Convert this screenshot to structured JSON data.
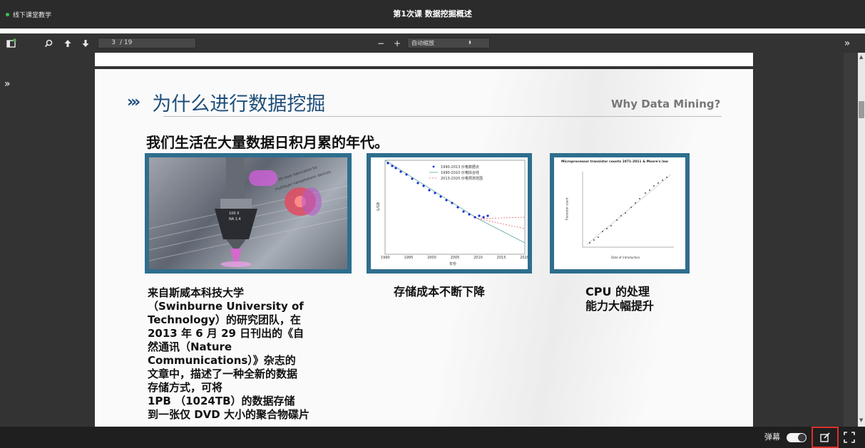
{
  "header": {
    "live_label": "线下课堂教学",
    "course_title": "第1次课 数据挖掘概述",
    "live_color": "#37c24a"
  },
  "toolbar": {
    "page_current": "3",
    "page_total": "/ 19",
    "zoom_minus": "−",
    "zoom_plus": "+",
    "zoom_value": "自动缩放",
    "sidebar_icon": "sidebar-toggle-icon",
    "find_icon": "search-icon",
    "prev_icon": "arrow-up-icon",
    "next_icon": "arrow-down-icon",
    "tools_label": "»"
  },
  "viewer": {
    "sidebar_expand": "»"
  },
  "slide": {
    "title_chevrons": "›››",
    "title": "为什么进行数据挖掘",
    "title_en": "Why Data Mining?",
    "subtitle": "我们生活在大量数据日积月累的年代。",
    "accent_color": "#1f4e79",
    "frame_color": "#2e6e8e",
    "cards": [
      {
        "lines": [
          "来自斯威本科技大学",
          "（Swinburne University of",
          "Technology）的研究团队，在",
          "2013 年 6 月 29 日刊出的《自",
          "然通讯（Nature",
          "Communications）》杂志的",
          "文章中，描述了一种全新的数据",
          "存储方式，可将",
          "1PB （1024TB）的数据存储",
          "到一张仅 DVD 大小的聚合物碟片"
        ]
      },
      {
        "lines": [
          "存储成本不断下降"
        ]
      },
      {
        "lines": [
          "CPU 的处理",
          "能力大幅提升"
        ]
      }
    ],
    "photo_labels": [
      "100 X",
      "NA 1.4",
      "3D laser fabrication for",
      "multilayer nanophotonic devices"
    ],
    "chart2": {
      "legend": [
        "1990-2013 价格数据点",
        "1990-2010 价格拟合线",
        "2013-2020 价格预测范围"
      ],
      "x_ticks": [
        "1990",
        "1995",
        "2000",
        "2005",
        "2010",
        "2015",
        "2020"
      ],
      "xlabel": "年份",
      "ylabel": "$/GB"
    },
    "chart3": {
      "title": "Microprocessor transistor counts 1971-2011 & Moore's law",
      "xlabel": "Date of introduction",
      "ylabel": "Transistor count"
    }
  },
  "footer": {
    "danmu_label": "弹幕",
    "danmu_on": true,
    "edit_icon": "edit-icon",
    "fullscreen_icon": "fullscreen-icon"
  }
}
